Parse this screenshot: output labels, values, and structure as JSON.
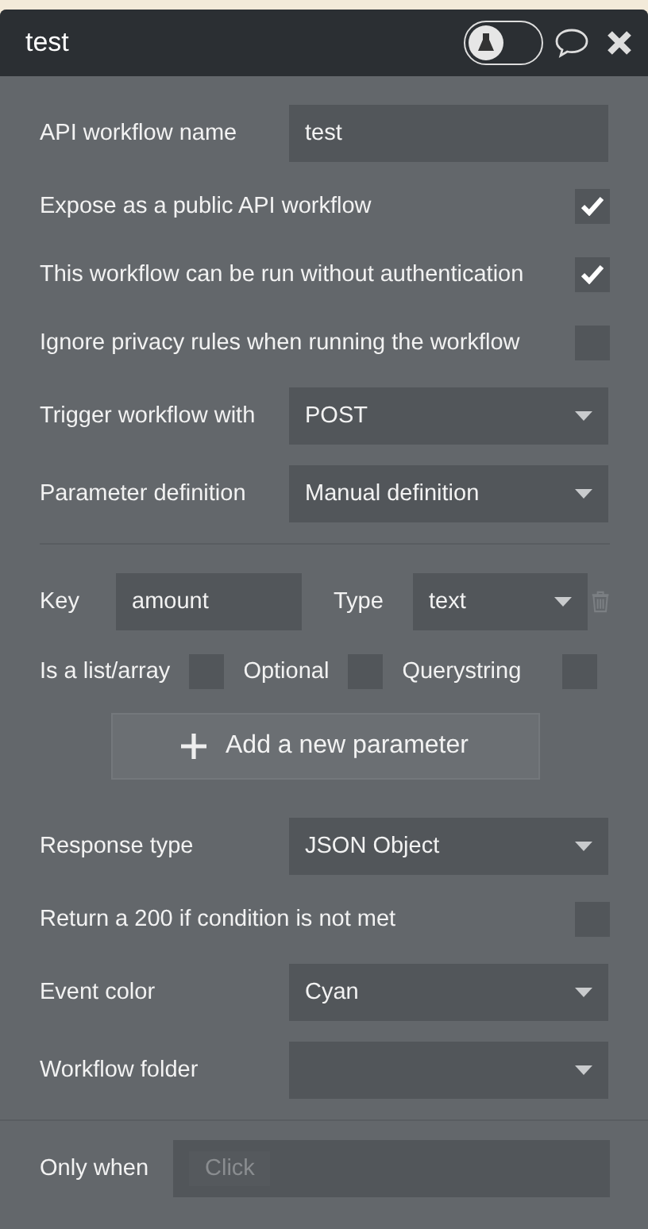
{
  "header": {
    "title": "test",
    "toggle_on": false
  },
  "fields": [
    {
      "kind": "text",
      "label": "API workflow name",
      "value": "test"
    },
    {
      "kind": "checkbox",
      "label": "Expose as a public API workflow",
      "checked": true
    },
    {
      "kind": "checkbox",
      "label": "This workflow can be run without authentication",
      "checked": true
    },
    {
      "kind": "checkbox",
      "label": "Ignore privacy rules when running the workflow",
      "checked": false
    },
    {
      "kind": "select",
      "label": "Trigger workflow with",
      "value": "POST"
    },
    {
      "kind": "select",
      "label": "Parameter definition",
      "value": "Manual definition"
    }
  ],
  "parameters": [
    {
      "key_label": "Key",
      "key": "amount",
      "type_label": "Type",
      "type": "text",
      "flags": [
        {
          "label": "Is a list/array",
          "checked": false
        },
        {
          "label": "Optional",
          "checked": false
        },
        {
          "label": "Querystring",
          "checked": false
        }
      ]
    }
  ],
  "add_button": "Add a new parameter",
  "settings": [
    {
      "kind": "select",
      "label": "Response type",
      "value": "JSON Object"
    },
    {
      "kind": "checkbox",
      "label": "Return a 200 if condition is not met",
      "checked": false
    },
    {
      "kind": "select",
      "label": "Event color",
      "value": "Cyan"
    },
    {
      "kind": "select",
      "label": "Workflow folder"
    }
  ],
  "only_when": {
    "label": "Only when",
    "chip": "Click"
  }
}
